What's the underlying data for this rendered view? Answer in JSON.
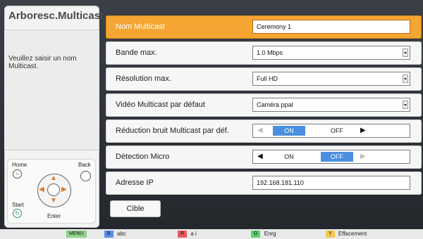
{
  "left_panel": {
    "title": "Arboresc.Multicast",
    "message": "Veuillez saisir un nom Multicast.",
    "remote": {
      "home": "Home",
      "back": "Back",
      "start": "Start",
      "enter": "Enter"
    }
  },
  "menu": {
    "rows": [
      {
        "label": "Nom Multicast",
        "value": "Ceremony 1"
      },
      {
        "label": "Bande max.",
        "value": "1.0 Mbps"
      },
      {
        "label": "Résolution max.",
        "value": "Full HD"
      },
      {
        "label": "Vidéo Multicast par défaut",
        "value": "Caméra ppal"
      },
      {
        "label": "Réduction bruit Multicast par déf.",
        "on": "ON",
        "off": "OFF",
        "selected_option": "ON"
      },
      {
        "label": "Détection Micro",
        "on": "ON",
        "off": "OFF",
        "selected_option": "OFF"
      },
      {
        "label": "Adresse IP",
        "value": "192.168.181.110"
      }
    ],
    "cible_button": "Cible"
  },
  "bottom_bar": {
    "keys": [
      {
        "badge": "MENU",
        "label": "",
        "color": "#8fd18a"
      },
      {
        "badge": "B",
        "label": "abc",
        "color": "#5b8fe8"
      },
      {
        "badge": "R",
        "label": "a i",
        "color": "#e85a5a"
      },
      {
        "badge": "G",
        "label": "Enrg",
        "color": "#5bcf6a"
      },
      {
        "badge": "Y",
        "label": "Effacement",
        "color": "#f2c94c"
      }
    ]
  },
  "colors": {
    "selected_row": "#f5a532",
    "toggle_active": "#4a8fe0"
  }
}
